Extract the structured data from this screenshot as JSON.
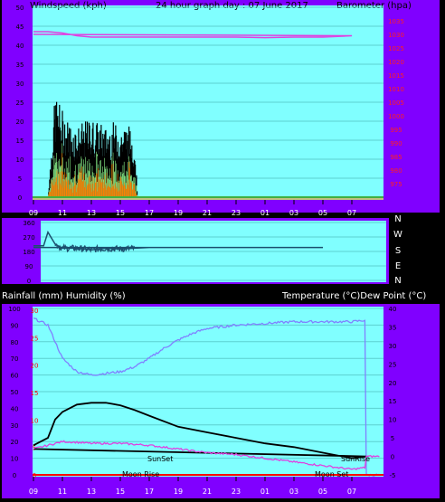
{
  "header": {
    "left": "Windspeed (kph)",
    "center": "24 hour graph day : 07 June 2017",
    "right": "Barometer (hpa)"
  },
  "x_axis_labels": [
    "11",
    "13",
    "15",
    "17",
    "19",
    "21",
    "23",
    "01",
    "03",
    "05",
    "07",
    "09"
  ],
  "colors": {
    "frame": "#8000ff",
    "plot_bg": "#80ffff",
    "wind_gust": "#000000",
    "wind_avg": "#80e080",
    "wind_orange": "#ff8000",
    "barometer": "#e040e0",
    "direction": "#1a4f6e",
    "temperature": "#000000",
    "dew_point": "#e040e0",
    "humidity": "#8080ff",
    "rain_axis": "#ff0000"
  },
  "chart_data": [
    {
      "type": "area",
      "panel": "wind",
      "ylim_left": [
        0,
        50
      ],
      "left_ticks": [
        "0",
        "5",
        "10",
        "15",
        "20",
        "25",
        "30",
        "35",
        "40",
        "45",
        "50"
      ],
      "ylim_right": [
        970,
        1040
      ],
      "right_ticks": [
        "975",
        "980",
        "985",
        "990",
        "995",
        "1000",
        "1005",
        "1010",
        "1015",
        "1020",
        "1025",
        "1030",
        "1035"
      ],
      "series": [
        {
          "name": "Windspeed (kph)",
          "x": [
            10.0,
            10.5,
            11.0,
            11.5,
            12.0,
            12.5,
            13.0,
            13.5,
            14.0,
            14.5,
            15.0,
            15.5,
            16.0,
            16.2
          ],
          "values": [
            0,
            25,
            21,
            18,
            17,
            18,
            19,
            18,
            17,
            18,
            17,
            18,
            14,
            0
          ]
        },
        {
          "name": "Barometer (hpa)",
          "x": [
            9.0,
            10.0,
            11.0,
            12.0,
            13.0,
            17.0,
            21.0,
            23.0,
            1.0,
            3.0,
            5.0,
            7.0,
            9.0
          ],
          "values": [
            1031,
            1031,
            1030.5,
            1029.5,
            1029,
            1029,
            1029,
            1029,
            1028.8,
            1029,
            1029,
            1029.5,
            1030
          ]
        }
      ]
    },
    {
      "type": "line",
      "panel": "direction",
      "ylim": [
        0,
        360
      ],
      "left_ticks": [
        "0",
        "90",
        "180",
        "270",
        "360"
      ],
      "right_labels": [
        "N",
        "W",
        "S",
        "E",
        "N"
      ],
      "series": [
        {
          "x": [
            9.0,
            9.7,
            10.0,
            10.5,
            11.0,
            12.0,
            13.0,
            14.0,
            15.0,
            16.0,
            17.0,
            21.0,
            1.0,
            5.0,
            9.0
          ],
          "values": [
            215,
            215,
            300,
            225,
            200,
            200,
            190,
            200,
            195,
            200,
            205,
            205,
            205,
            205,
            205
          ]
        }
      ]
    },
    {
      "type": "line",
      "panel": "climate",
      "left_label": "Rainfall (mm)  Humidity (%)",
      "right_label": "Temperature (°C)Dew Point (°C)",
      "ylim_left": [
        0,
        100
      ],
      "left_ticks": [
        "0",
        "10",
        "20",
        "30",
        "40",
        "50",
        "60",
        "70",
        "80",
        "90",
        "100"
      ],
      "rain_ticks": [
        "0",
        "5",
        "10",
        "15",
        "20",
        "25",
        "30"
      ],
      "ylim_right": [
        -5,
        40
      ],
      "right_ticks": [
        "-5",
        "0",
        "5",
        "10",
        "15",
        "20",
        "25",
        "30",
        "35",
        "40"
      ],
      "annotations": [
        "SunSet",
        "SunRise",
        "Moon Rise",
        "Moon Set"
      ],
      "series": [
        {
          "name": "Humidity (%)",
          "x": [
            9.0,
            10.0,
            11.0,
            12.0,
            13.0,
            14.0,
            15.0,
            16.0,
            17.0,
            18.0,
            19.0,
            20.0,
            21.0,
            23.0,
            1.0,
            3.0,
            5.0,
            7.0,
            8.0,
            9.0
          ],
          "values": [
            94,
            90,
            70,
            62,
            60,
            61,
            62,
            65,
            70,
            76,
            81,
            85,
            88,
            90,
            91,
            92,
            92,
            92,
            93,
            93
          ]
        },
        {
          "name": "Temperature (°C)",
          "x": [
            9.0,
            10.0,
            10.5,
            11.0,
            12.0,
            13.0,
            14.0,
            15.0,
            16.0,
            17.0,
            19.0,
            21.0,
            23.0,
            1.0,
            3.0,
            5.0,
            7.0,
            8.0,
            9.0
          ],
          "values": [
            3,
            5,
            10,
            12,
            14,
            14.5,
            14.5,
            13.8,
            12.5,
            11,
            8,
            6.5,
            5,
            3.5,
            2.5,
            1,
            -0.5,
            0,
            2
          ]
        },
        {
          "name": "Dew Point (°C)",
          "x": [
            9.0,
            10.0,
            11.0,
            12.0,
            13.0,
            15.0,
            17.0,
            19.0,
            21.0,
            23.0,
            1.0,
            3.0,
            5.0,
            7.0,
            8.0,
            9.0
          ],
          "values": [
            2,
            3,
            4,
            3.8,
            3.5,
            3.5,
            3,
            2,
            1,
            0.5,
            -0.5,
            -1.5,
            -2.5,
            -3.5,
            -3,
            -1
          ]
        },
        {
          "name": "Rainfall (mm)",
          "x": [
            9.0,
            9.0
          ],
          "values": [
            0,
            0
          ]
        }
      ]
    }
  ]
}
